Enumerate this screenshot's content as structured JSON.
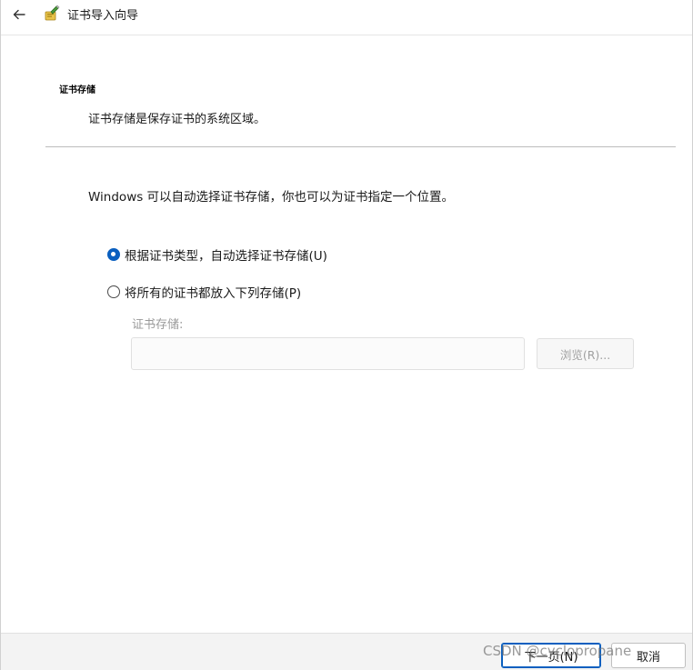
{
  "window": {
    "title": "证书导入向导",
    "back_icon": "arrow-left-icon",
    "wizard_icon": "certificate-wizard-icon"
  },
  "section": {
    "heading": "证书存储",
    "description": "证书存储是保存证书的系统区域。"
  },
  "intro": "Windows 可以自动选择证书存储，你也可以为证书指定一个位置。",
  "options": [
    {
      "label": "根据证书类型，自动选择证书存储(U)",
      "selected": true
    },
    {
      "label": "将所有的证书都放入下列存储(P)",
      "selected": false
    }
  ],
  "store": {
    "label": "证书存储:",
    "value": "",
    "browse_label": "浏览(R)..."
  },
  "footer": {
    "next_label": "下一页(N)",
    "cancel_label": "取消"
  },
  "watermark": "CSDN @cyclopropane",
  "colors": {
    "accent": "#0a5fbf",
    "disabled_text": "#9a9a9a",
    "footer_bg": "#f3f3f3"
  }
}
